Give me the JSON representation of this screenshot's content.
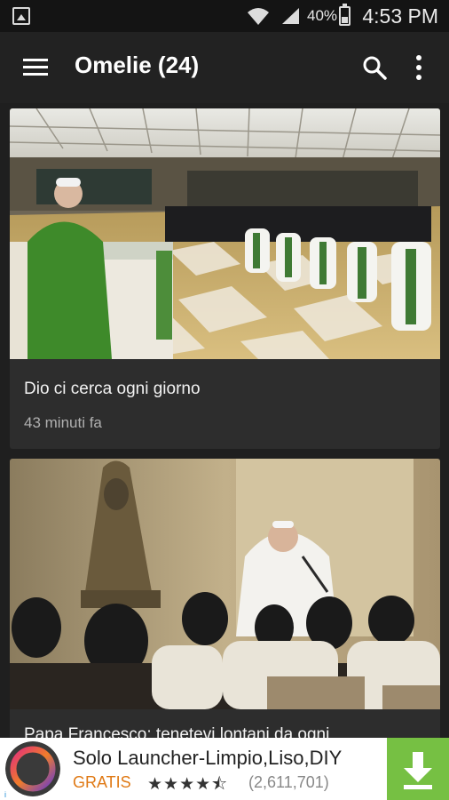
{
  "status_bar": {
    "battery_percent": "40%",
    "battery_level": 0.4,
    "time": "4:53 PM",
    "icons": [
      "notification-icon",
      "wifi-icon",
      "signal-icon",
      "battery-icon"
    ]
  },
  "app_bar": {
    "title": "Omelie (24)",
    "icons": [
      "menu-icon",
      "search-icon",
      "more-vert-icon"
    ]
  },
  "feed": {
    "items": [
      {
        "title": "Dio ci cerca ogni giorno",
        "time": "43 minuti fa"
      },
      {
        "title": "Papa Francesco: tenetevi lontani da ogni",
        "time": ""
      }
    ]
  },
  "ad": {
    "title": "Solo Launcher-Limpio,Liso,DIY",
    "price": "GRATIS",
    "stars": "★★★★⯪",
    "rating": 4.5,
    "rating_count": "(2,611,701)",
    "icons": [
      "solo-launcher-icon",
      "download-icon",
      "ad-info-icon"
    ],
    "colors": {
      "price": "#e07a16",
      "download_bg": "#76c043"
    }
  }
}
